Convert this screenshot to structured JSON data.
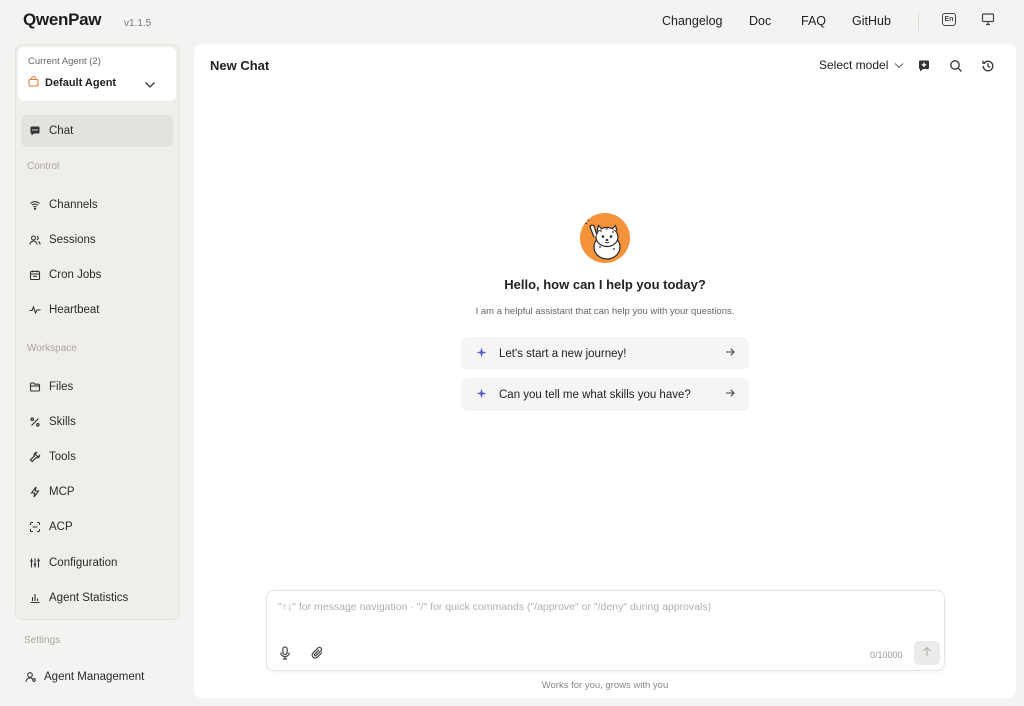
{
  "header": {
    "logo": "QwenPaw",
    "version": "v1.1.5",
    "nav": [
      "Changelog",
      "Doc",
      "FAQ",
      "GitHub"
    ],
    "lang_label": "En",
    "icons": [
      "language-icon",
      "monitor-icon"
    ]
  },
  "sidebar": {
    "agent_caption": "Current Agent (2)",
    "agent_name": "Default Agent",
    "chat_label": "Chat",
    "control_label": "Control",
    "control_items": [
      {
        "label": "Channels",
        "icon": "wifi-icon"
      },
      {
        "label": "Sessions",
        "icon": "users-icon"
      },
      {
        "label": "Cron Jobs",
        "icon": "calendar-icon"
      },
      {
        "label": "Heartbeat",
        "icon": "pulse-icon"
      }
    ],
    "workspace_label": "Workspace",
    "workspace_items": [
      {
        "label": "Files",
        "icon": "folder-icon"
      },
      {
        "label": "Skills",
        "icon": "percent-icon"
      },
      {
        "label": "Tools",
        "icon": "wrench-icon"
      },
      {
        "label": "MCP",
        "icon": "bolt-icon"
      },
      {
        "label": "ACP",
        "icon": "scan-icon"
      },
      {
        "label": "Configuration",
        "icon": "sliders-icon"
      },
      {
        "label": "Agent Statistics",
        "icon": "bar-chart-icon"
      }
    ],
    "settings_label": "Settings",
    "agent_management": "Agent Management"
  },
  "main": {
    "title": "New Chat",
    "model_select": "Select model",
    "greeting": "Hello, how can I help you today?",
    "subtitle": "I am a helpful assistant that can help you with your questions.",
    "prompts": [
      "Let's start a new journey!",
      "Can you tell me what skills you have?"
    ],
    "composer": {
      "placeholder": "\"↑↓\" for message navigation · \"/\" for quick commands (\"/approve\" or \"/deny\" during approvals)",
      "value": "",
      "char_count": "0/10000"
    },
    "footer": "Works for you, grows with you"
  },
  "colors": {
    "background": "#f4f3f1",
    "panel": "#ffffff",
    "active_nav": "#e4e2df",
    "mascot": "#f4933b",
    "sparkle": "#5b5bd6",
    "agent_icon": "#e8803a"
  }
}
